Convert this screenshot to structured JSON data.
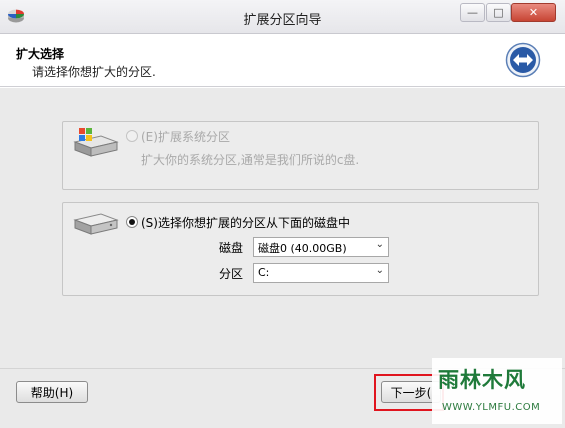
{
  "window": {
    "title": "扩展分区向导",
    "controls": {
      "minimize": "—",
      "maximize": "□",
      "close": "✕"
    },
    "app_icon": "multicolor-disk-icon"
  },
  "header": {
    "title": "扩大选择",
    "subtitle": "请选择你想扩大的分区.",
    "icon": "expand-arrows-icon"
  },
  "options": {
    "system_partition": {
      "label": "(E)扩展系统分区",
      "description": "扩大你的系统分区,通常是我们所说的c盘.",
      "enabled": false,
      "selected": false,
      "icon": "windows-disk-icon"
    },
    "select_partition": {
      "label": "(S)选择你想扩展的分区从下面的磁盘中",
      "enabled": true,
      "selected": true,
      "icon": "hard-disk-icon",
      "disk_label": "磁盘",
      "disk_value": "磁盘0 (40.00GB)",
      "partition_label": "分区",
      "partition_value": "C:"
    }
  },
  "footer": {
    "help_label": "帮助(H)",
    "next_label": "下一步(",
    "highlight_color": "#e0141e"
  },
  "watermark": {
    "text": "雨林木风",
    "url": "WWW.YLMFU.COM"
  }
}
